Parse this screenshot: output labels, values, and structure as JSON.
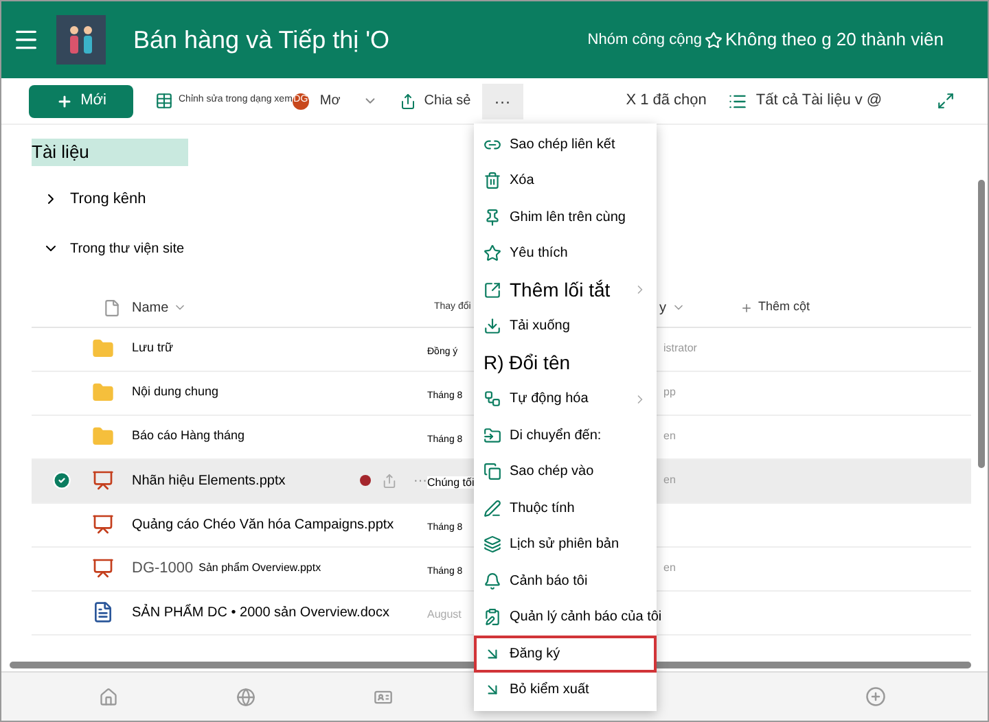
{
  "header": {
    "title": "Bán hàng và Tiếp thị 'O",
    "group_type": "Nhóm công cộng",
    "follow": "Không theo g 20 thành viên"
  },
  "toolbar": {
    "new": "Mới",
    "edit_grid": "Chỉnh sửa trong dạng xem",
    "badge": "DG",
    "more_label": "Mơ",
    "share": "Chia sẻ",
    "more": "···",
    "selected_count": "X 1 đã chọn",
    "view": "Tất cả Tài liệu v @"
  },
  "page_title": "Tài liệu",
  "sections": [
    {
      "label": "Trong kênh",
      "expanded": false
    },
    {
      "label": "Trong thư viện site",
      "expanded": true
    }
  ],
  "table": {
    "columns": [
      "Name",
      "Thay đổi",
      "y",
      "Thêm cột"
    ],
    "rows": [
      {
        "kind": "folder",
        "name": "Lưu trữ",
        "modified": "Đồng ý",
        "modified_by": "istrator",
        "selected": false
      },
      {
        "kind": "folder",
        "name": "Nội dung chung",
        "modified": "Tháng 8",
        "modified_by": "pp",
        "selected": false
      },
      {
        "kind": "folder",
        "name": "Báo cáo Hàng tháng",
        "modified": "Tháng 8",
        "modified_by": "en",
        "selected": false
      },
      {
        "kind": "pptx",
        "name": "Nhãn hiệu Elements.pptx",
        "modified": "Chúng tối",
        "modified_by": "en",
        "selected": true,
        "actions": "···"
      },
      {
        "kind": "pptx",
        "name": "Quảng cáo Chéo Văn hóa Campaigns.pptx",
        "modified": "Tháng 8",
        "selected": false
      },
      {
        "kind": "pptx",
        "name_prefix": "DG-1000",
        "name": "Sản phẩm Overview.pptx",
        "modified": "Tháng 8",
        "modified_by": "en",
        "selected": false
      },
      {
        "kind": "docx",
        "name": "SẢN PHẨM DC • 2000 sản Overview.docx",
        "modified": "August",
        "selected": false
      }
    ]
  },
  "menu": [
    {
      "kind": "link",
      "label": "Sao chép liên kết",
      "selected": false
    },
    {
      "kind": "trash",
      "label": "Xóa",
      "selected": false
    },
    {
      "kind": "pin",
      "label": "Ghim lên trên cùng",
      "selected": false
    },
    {
      "kind": "star",
      "label": "Yêu thích",
      "selected": false
    },
    {
      "kind": "shortcut",
      "label": "Thêm lối tắt",
      "large": true,
      "submenu": true,
      "selected": false
    },
    {
      "kind": "download",
      "label": "Tải xuống",
      "selected": false
    },
    {
      "kind": "none",
      "label": "R) Đổi tên",
      "large": true,
      "selected": false
    },
    {
      "kind": "flow",
      "label": "Tự động hóa",
      "submenu": true,
      "selected": false
    },
    {
      "kind": "move",
      "label": "Di chuyển đến:",
      "selected": false
    },
    {
      "kind": "copy",
      "label": "Sao chép vào",
      "selected": false
    },
    {
      "kind": "pencil",
      "label": "Thuộc tính",
      "selected": false
    },
    {
      "kind": "history",
      "label": "Lịch sử phiên bản",
      "selected": false
    },
    {
      "kind": "bell",
      "label": "Cảnh báo tôi",
      "selected": false
    },
    {
      "kind": "alerts",
      "label": "Quản lý cảnh báo của tôi",
      "selected": false
    },
    {
      "kind": "arrow",
      "label": "Đăng ký",
      "selected": true
    },
    {
      "kind": "arrow",
      "label": "Bỏ kiểm xuất",
      "selected": false
    }
  ]
}
